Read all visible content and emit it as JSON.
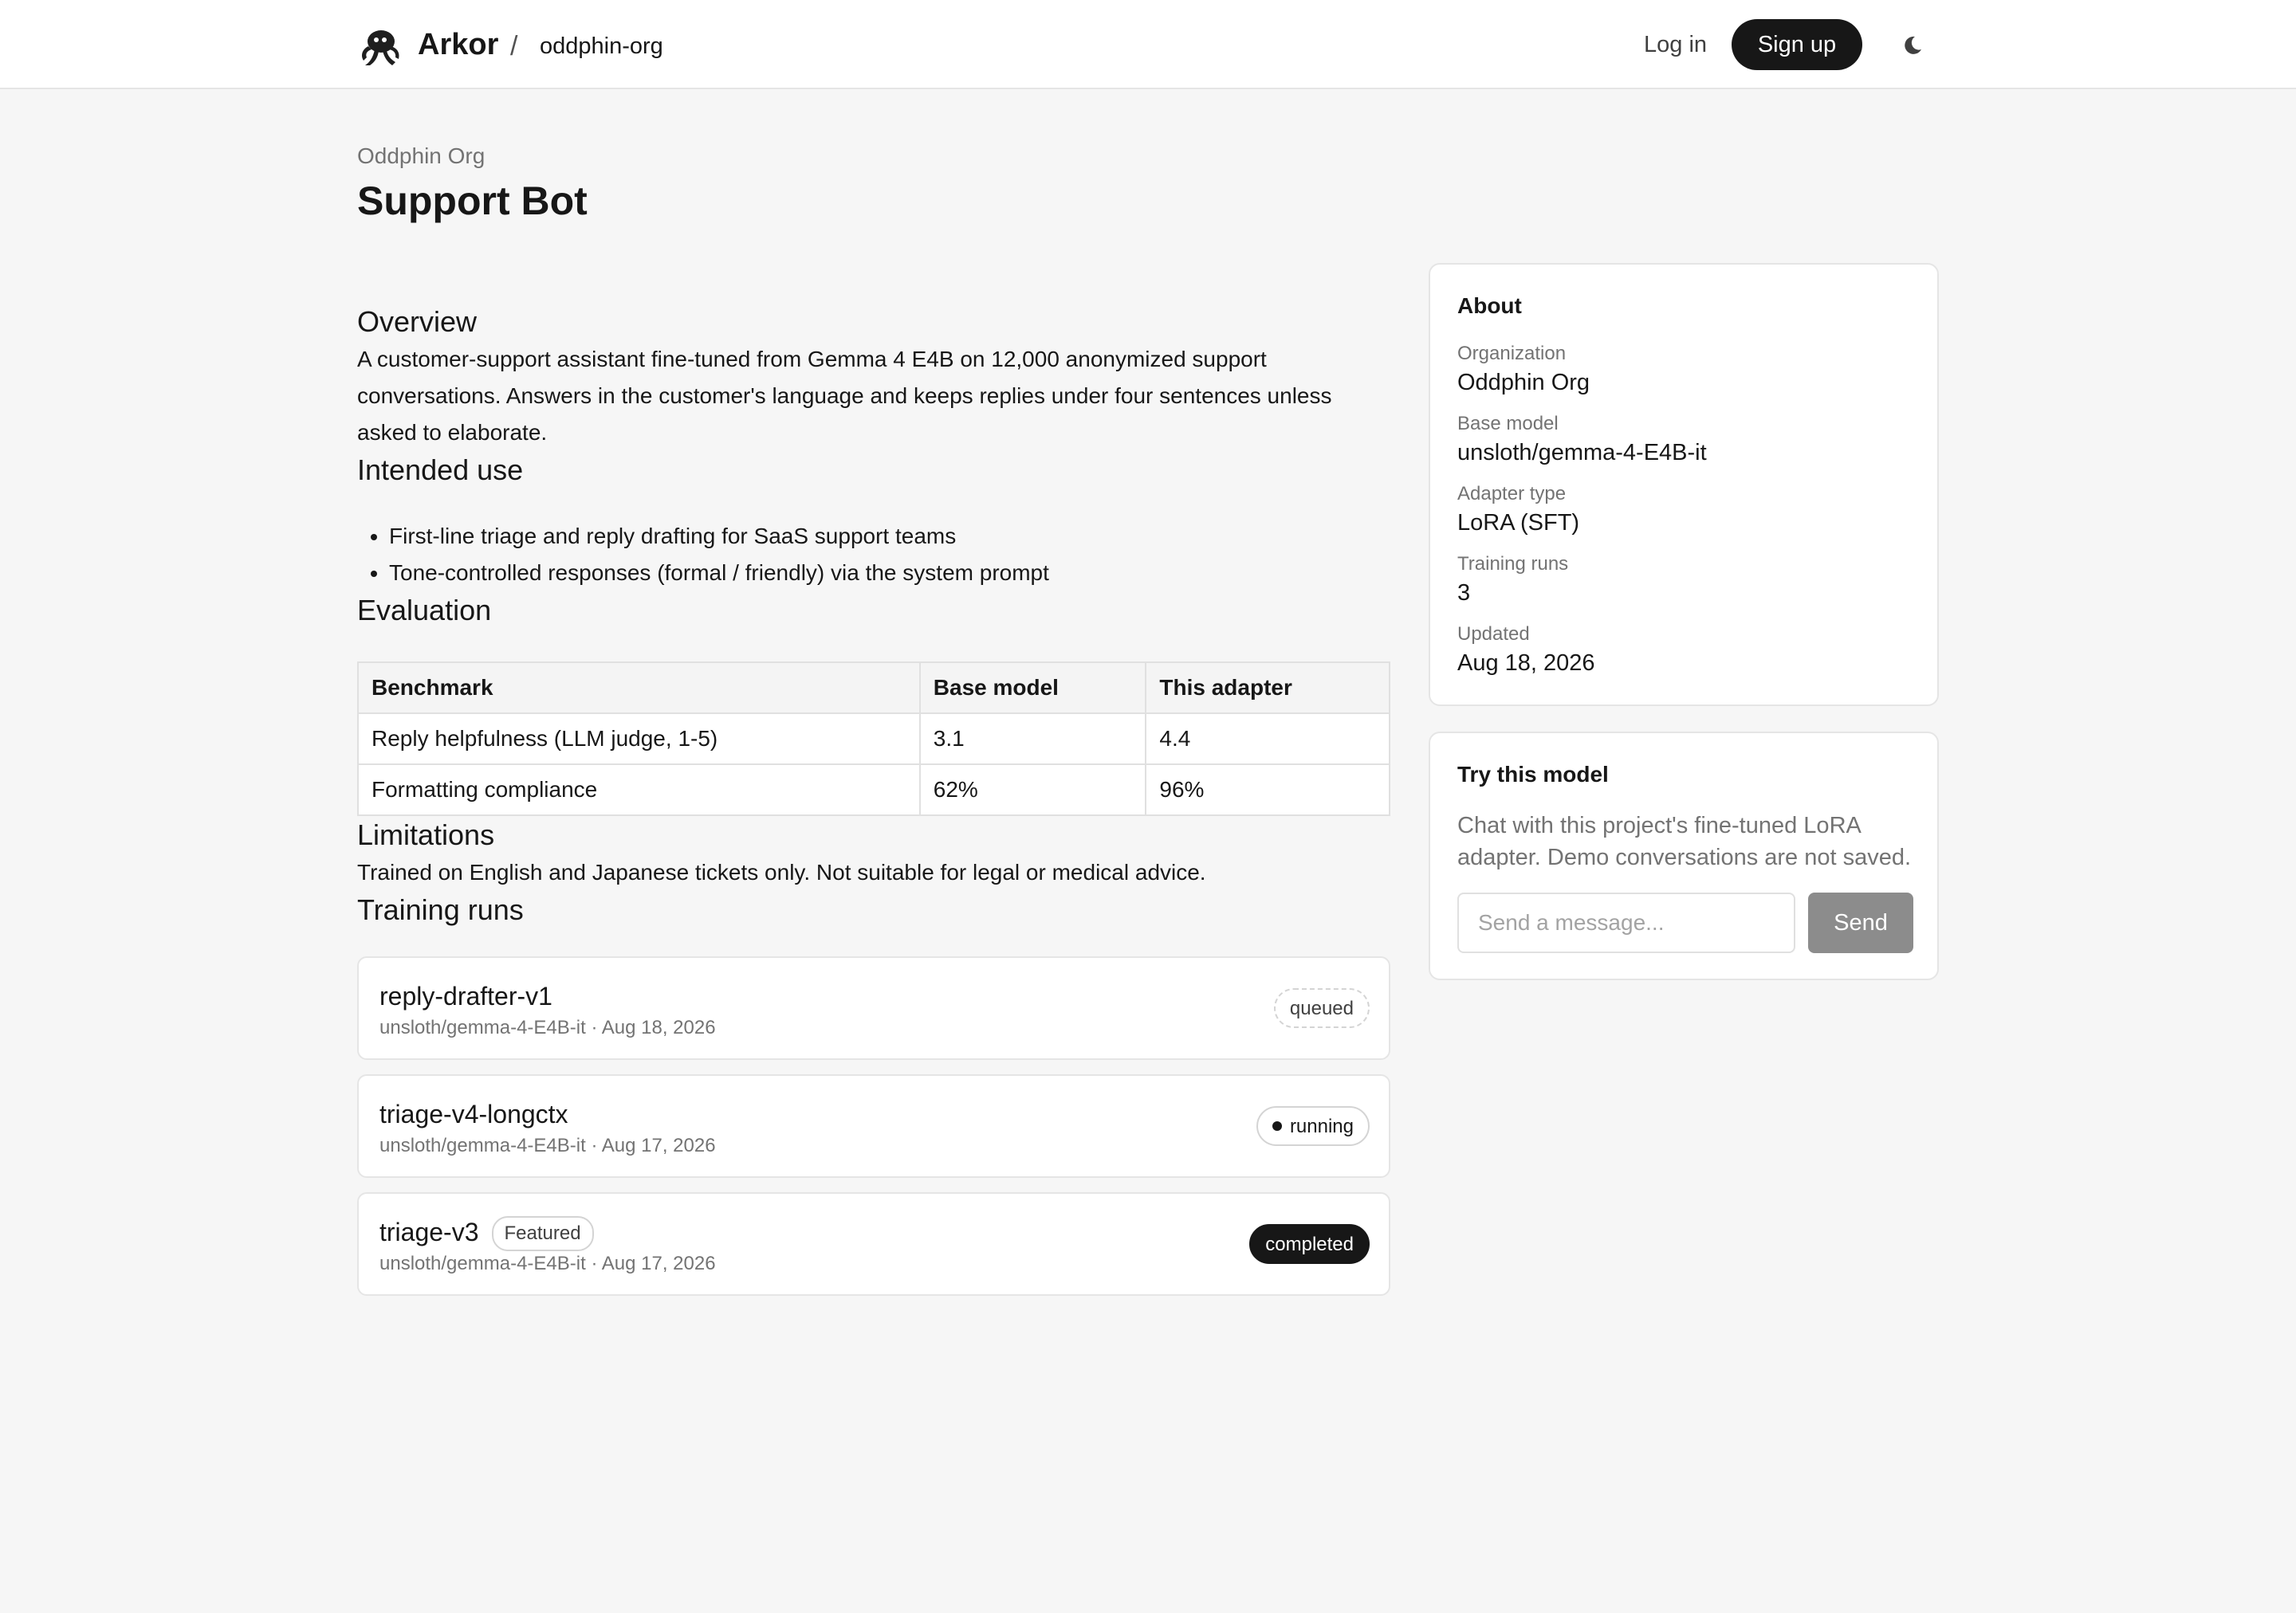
{
  "header": {
    "brand": "Arkor",
    "separator": "/",
    "org_slug": "oddphin-org",
    "login_label": "Log in",
    "signup_label": "Sign up",
    "theme_icon": "moon-icon",
    "logo_icon": "octopus-logo-icon"
  },
  "page": {
    "org_name": "Oddphin Org",
    "title": "Support Bot"
  },
  "overview": {
    "heading": "Overview",
    "text": "A customer-support assistant fine-tuned from Gemma 4 E4B on 12,000 anonymized support conversations. Answers in the customer's language and keeps replies under four sentences unless asked to elaborate."
  },
  "intended_use": {
    "heading": "Intended use",
    "items": [
      "First-line triage and reply drafting for SaaS support teams",
      "Tone-controlled responses (formal / friendly) via the system prompt"
    ]
  },
  "evaluation": {
    "heading": "Evaluation",
    "columns": [
      "Benchmark",
      "Base model",
      "This adapter"
    ],
    "rows": [
      [
        "Reply helpfulness (LLM judge, 1-5)",
        "3.1",
        "4.4"
      ],
      [
        "Formatting compliance",
        "62%",
        "96%"
      ]
    ]
  },
  "limitations": {
    "heading": "Limitations",
    "text": "Trained on English and Japanese tickets only. Not suitable for legal or medical advice."
  },
  "training_runs": {
    "heading": "Training runs",
    "runs": [
      {
        "name": "reply-drafter-v1",
        "meta": "unsloth/gemma-4-E4B-it · Aug 18, 2026",
        "status": "queued",
        "featured": ""
      },
      {
        "name": "triage-v4-longctx",
        "meta": "unsloth/gemma-4-E4B-it · Aug 17, 2026",
        "status": "running",
        "featured": ""
      },
      {
        "name": "triage-v3",
        "meta": "unsloth/gemma-4-E4B-it · Aug 17, 2026",
        "status": "completed",
        "featured": "Featured"
      }
    ]
  },
  "about": {
    "title": "About",
    "fields": [
      {
        "label": "Organization",
        "value": "Oddphin Org"
      },
      {
        "label": "Base model",
        "value": "unsloth/gemma-4-E4B-it"
      },
      {
        "label": "Adapter type",
        "value": "LoRA (SFT)"
      },
      {
        "label": "Training runs",
        "value": "3"
      },
      {
        "label": "Updated",
        "value": "Aug 18, 2026"
      }
    ]
  },
  "try_model": {
    "title": "Try this model",
    "description": "Chat with this project's fine-tuned LoRA adapter. Demo conversations are not saved.",
    "placeholder": "Send a message...",
    "send_label": "Send"
  },
  "colors": {
    "background": "#f6f6f6",
    "surface": "#ffffff",
    "primary": "#171717",
    "muted_text": "#737373",
    "disabled_button": "#8c8c8c"
  }
}
